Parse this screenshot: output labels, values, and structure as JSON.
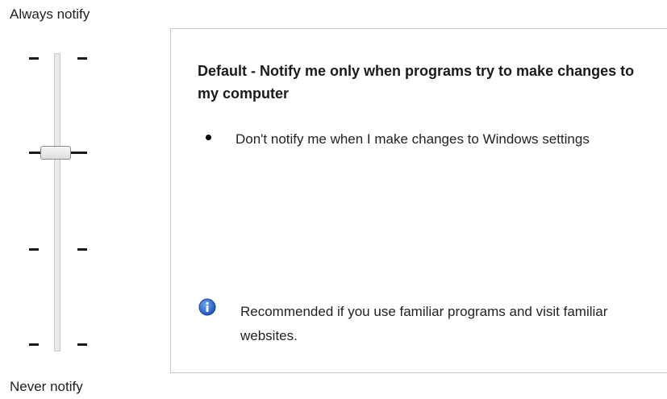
{
  "labels": {
    "top": "Always notify",
    "bottom": "Never notify"
  },
  "slider": {
    "levels": 4,
    "selected_level": 3,
    "selected_label": "Default"
  },
  "description": {
    "heading": "Default - Notify me only when programs try to make changes to my computer",
    "bullet": "Don't notify me when I make changes to Windows settings",
    "info_icon": "info-icon",
    "info": "Recommended if you use familiar programs and visit familiar websites."
  },
  "colors": {
    "info_icon": "#1f5fc4",
    "text": "#1a1a1a"
  }
}
